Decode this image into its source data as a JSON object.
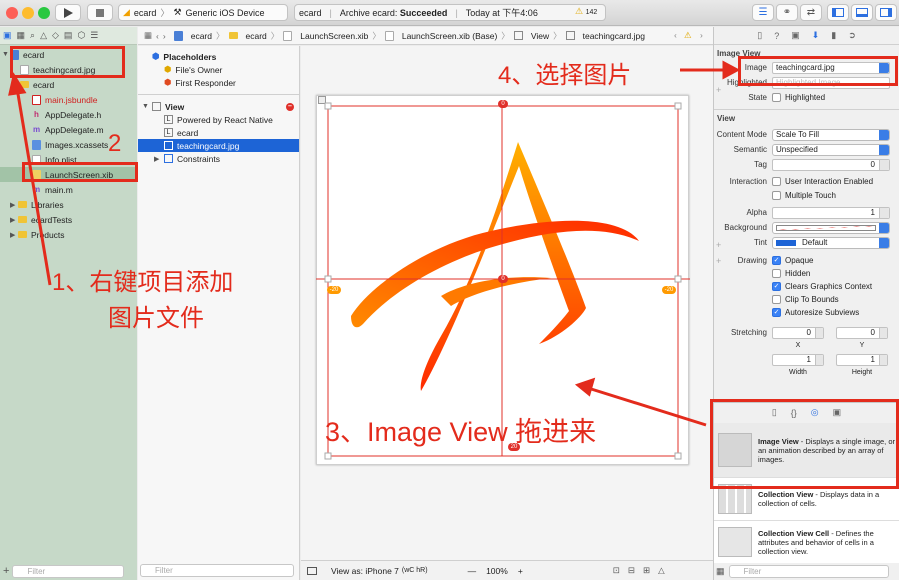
{
  "toolbar": {
    "scheme": "ecard",
    "device": "Generic iOS Device",
    "activity_project": "ecard",
    "activity_status_prefix": "Archive ecard:",
    "activity_status": "Succeeded",
    "activity_time": "Today at 下午4:06",
    "warning_count": "142"
  },
  "navigator": {
    "items": [
      {
        "label": "ecard",
        "depth": 0,
        "kind": "project"
      },
      {
        "label": "teachingcard.jpg",
        "depth": 1,
        "kind": "image"
      },
      {
        "label": "ecard",
        "depth": 1,
        "kind": "folder"
      },
      {
        "label": "main.jsbundle",
        "depth": 2,
        "kind": "file-red"
      },
      {
        "label": "AppDelegate.h",
        "depth": 2,
        "kind": "h"
      },
      {
        "label": "AppDelegate.m",
        "depth": 2,
        "kind": "m"
      },
      {
        "label": "Images.xcassets",
        "depth": 2,
        "kind": "assets"
      },
      {
        "label": "Info.plist",
        "depth": 2,
        "kind": "plist"
      },
      {
        "label": "LaunchScreen.xib",
        "depth": 2,
        "kind": "xib",
        "selected": true
      },
      {
        "label": "main.m",
        "depth": 2,
        "kind": "m"
      },
      {
        "label": "Libraries",
        "depth": 1,
        "kind": "folder"
      },
      {
        "label": "ecardTests",
        "depth": 1,
        "kind": "folder"
      },
      {
        "label": "Products",
        "depth": 1,
        "kind": "folder"
      }
    ],
    "filter_placeholder": "Filter"
  },
  "jumpbar": {
    "crumbs": [
      "ecard",
      "ecard",
      "LaunchScreen.xib",
      "LaunchScreen.xib (Base)",
      "View",
      "teachingcard.jpg"
    ]
  },
  "outline": {
    "placeholders_title": "Placeholders",
    "placeholders": [
      "File's Owner",
      "First Responder"
    ],
    "view_title": "View",
    "children": [
      {
        "label": "Powered by React Native",
        "icon": "L"
      },
      {
        "label": "ecard",
        "icon": "L"
      },
      {
        "label": "teachingcard.jpg",
        "icon": "img",
        "selected": true
      },
      {
        "label": "Constraints",
        "icon": "c"
      }
    ],
    "filter_placeholder": "Filter"
  },
  "canvas": {
    "constraint_left": "-20",
    "constraint_right": "-20",
    "constraint_top": "0",
    "constraint_center": "0",
    "constraint_bottom": "20"
  },
  "bottom_bar": {
    "view_as": "View as: iPhone 7",
    "size_class": "(wC hR)",
    "minus": "—",
    "zoom": "100%",
    "plus": "+"
  },
  "inspector": {
    "title": "Image View",
    "image_label": "Image",
    "image_value": "teachingcard.jpg",
    "highlighted_label": "Highlighted",
    "highlighted_placeholder": "Highlighted Image",
    "state_label": "State",
    "state_value": "Highlighted",
    "view_section": "View",
    "content_mode_label": "Content Mode",
    "content_mode_value": "Scale To Fill",
    "semantic_label": "Semantic",
    "semantic_value": "Unspecified",
    "tag_label": "Tag",
    "tag_value": "0",
    "interaction_label": "Interaction",
    "interaction_options": [
      {
        "label": "User Interaction Enabled",
        "checked": false
      },
      {
        "label": "Multiple Touch",
        "checked": false
      }
    ],
    "alpha_label": "Alpha",
    "alpha_value": "1",
    "background_label": "Background",
    "tint_label": "Tint",
    "tint_value": "Default",
    "drawing_label": "Drawing",
    "drawing_options": [
      {
        "label": "Opaque",
        "checked": true
      },
      {
        "label": "Hidden",
        "checked": false
      },
      {
        "label": "Clears Graphics Context",
        "checked": true
      },
      {
        "label": "Clip To Bounds",
        "checked": false
      },
      {
        "label": "Autoresize Subviews",
        "checked": true
      }
    ],
    "stretching_label": "Stretching",
    "stretch_x": "0",
    "stretch_y": "0",
    "stretch_x_label": "X",
    "stretch_y_label": "Y",
    "stretch_w": "1",
    "stretch_h": "1",
    "width_label": "Width",
    "height_label": "Height"
  },
  "library": {
    "items": [
      {
        "title": "Image View",
        "desc": " - Displays a single image, or an animation described by an array of images."
      },
      {
        "title": "Collection View",
        "desc": " - Displays data in a collection of cells."
      },
      {
        "title": "Collection View Cell",
        "desc": " - Defines the attributes and behavior of cells in a collection view."
      }
    ],
    "filter_placeholder": "Filter"
  },
  "annotations": {
    "step1_line1": "1、右键项目添加",
    "step1_line2": "图片文件",
    "step2": "2",
    "step3": "3、Image View 拖进来",
    "step4": "4、选择图片"
  },
  "colors": {
    "annotation_red": "#e32b1c",
    "selection_blue": "#1d64d6",
    "navigator_green": "#c6d9c8",
    "logo_orange": "#ff9a00",
    "logo_red": "#ff2a00"
  }
}
